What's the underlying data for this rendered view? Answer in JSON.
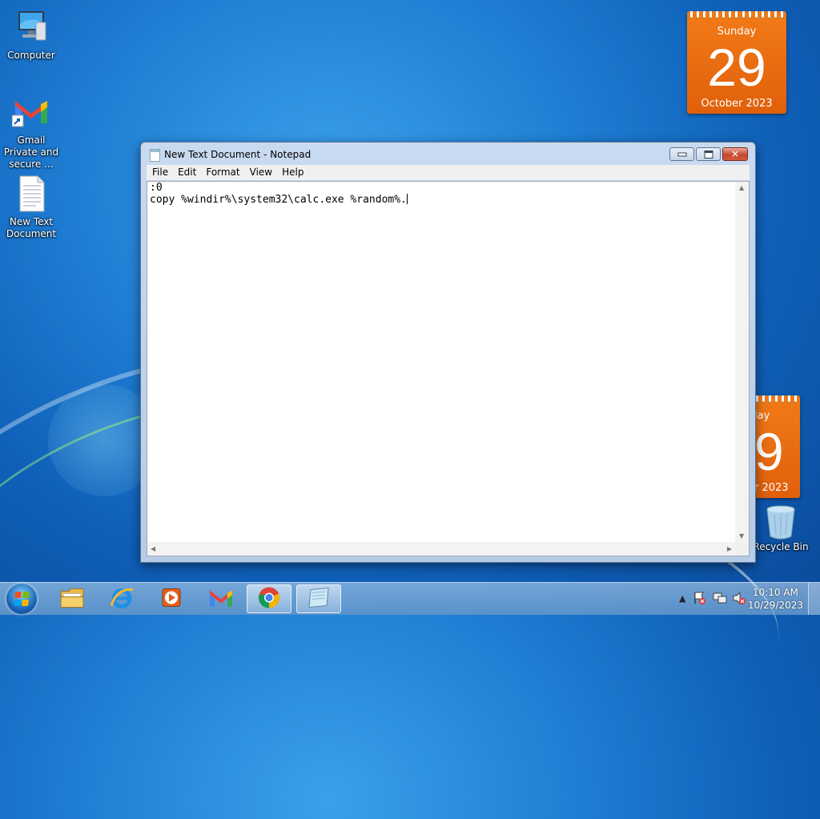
{
  "desktop": {
    "icons": [
      {
        "label": "Computer"
      },
      {
        "label": "Gmail  Private and secure ..."
      },
      {
        "label": "New Text Document"
      },
      {
        "label": "Recycle Bin"
      }
    ]
  },
  "calendar_gadget": {
    "weekday": "Sunday",
    "day": "29",
    "month_year": "October 2023"
  },
  "calendar_gadget_partial": {
    "weekday_fragment": "lay",
    "day_fragment": "9",
    "month_fragment": "r 2023"
  },
  "notepad": {
    "title": "New Text Document - Notepad",
    "menu": [
      "File",
      "Edit",
      "Format",
      "View",
      "Help"
    ],
    "content_lines": [
      ":0",
      "copy %windir%\\system32\\calc.exe %random%."
    ]
  },
  "taskbar": {
    "apps": [
      "start-menu",
      "file-explorer",
      "internet-explorer",
      "media-player",
      "gmail",
      "chrome",
      "notepad"
    ],
    "active_app": "notepad",
    "clock_time": "10:10 AM",
    "clock_date": "10/29/2023"
  },
  "colors": {
    "calendar": "#e8680f",
    "close_button": "#c7472e",
    "taskbar": "#8fb6dc"
  }
}
